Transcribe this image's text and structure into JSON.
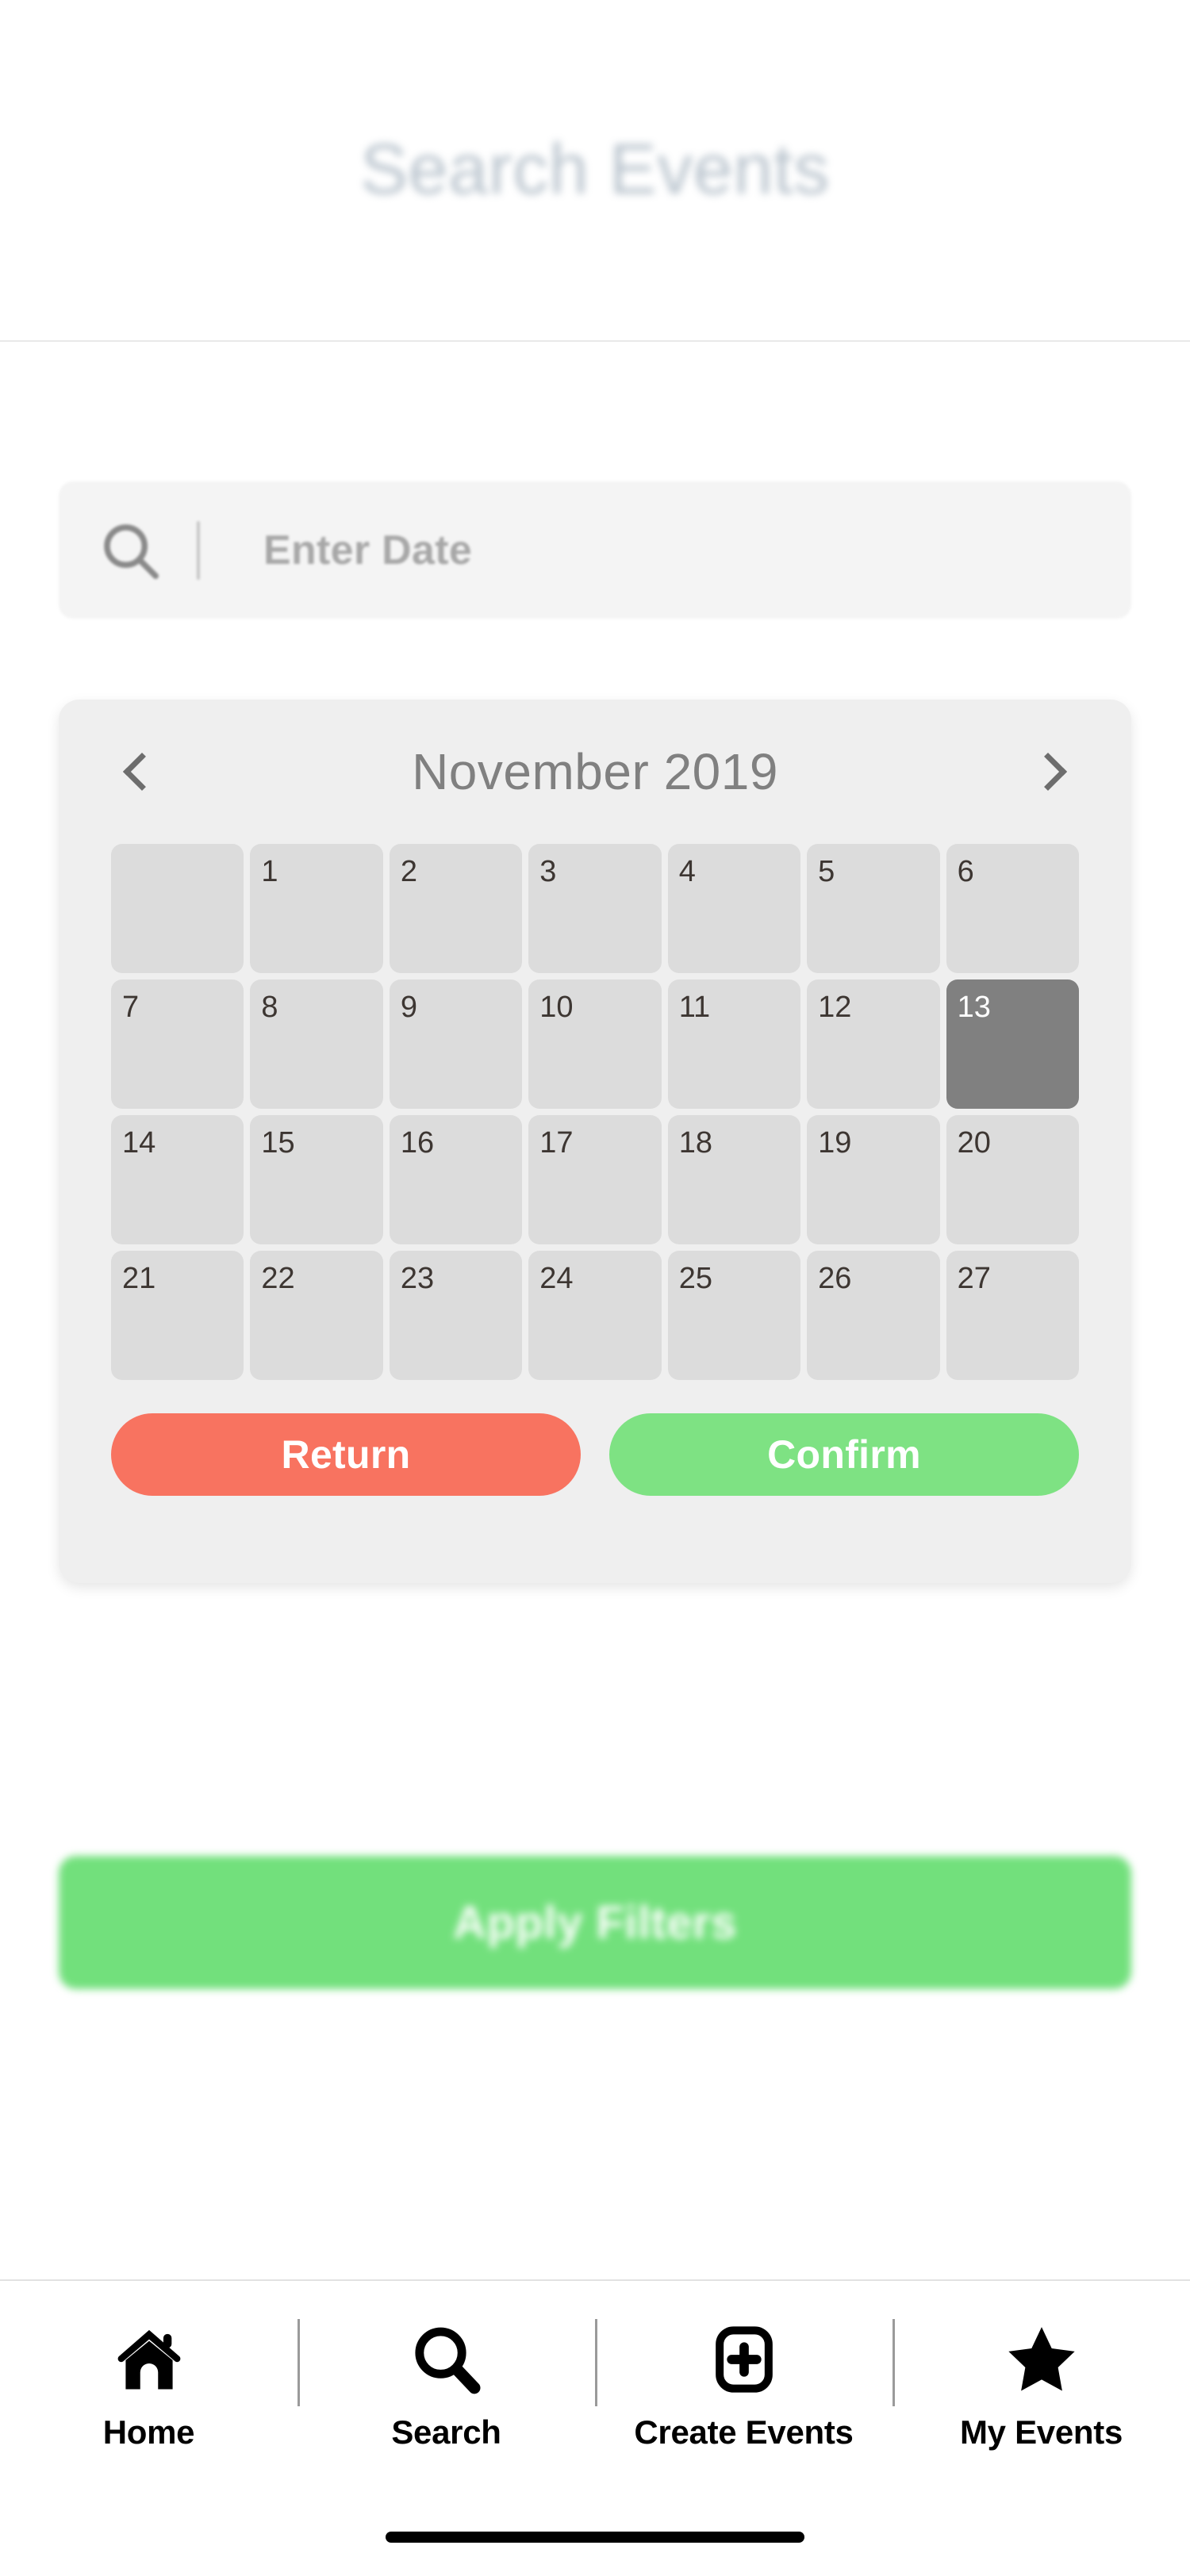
{
  "header": {
    "title": "Search Events"
  },
  "search": {
    "icon": "search-icon",
    "placeholder": "Enter Date",
    "value": ""
  },
  "calendar": {
    "prev_icon": "chevron-left-icon",
    "next_icon": "chevron-right-icon",
    "month_year": "November 2019",
    "month": "November",
    "year": "2019",
    "leading_blanks": 1,
    "days": [
      "1",
      "2",
      "3",
      "4",
      "5",
      "6",
      "7",
      "8",
      "9",
      "10",
      "11",
      "12",
      "13",
      "14",
      "15",
      "16",
      "17",
      "18",
      "19",
      "20",
      "21",
      "22",
      "23",
      "24",
      "25",
      "26",
      "27"
    ],
    "selected_day": "13",
    "return_label": "Return",
    "confirm_label": "Confirm",
    "colors": {
      "card_bg": "#efefef",
      "cell_bg": "#dcdcdc",
      "selected_bg": "#808080",
      "return_bg": "#f87360",
      "confirm_bg": "#7ee283"
    }
  },
  "filters": {
    "apply_label": "Apply Filters",
    "apply_color": "#72e07c"
  },
  "bottom_nav": {
    "active": "Search",
    "active_indicator_color": "#2f4f3e",
    "items": [
      {
        "label": "Home",
        "icon": "home-icon"
      },
      {
        "label": "Search",
        "icon": "search-icon"
      },
      {
        "label": "Create Events",
        "icon": "plus-square-icon"
      },
      {
        "label": "My Events",
        "icon": "star-icon"
      }
    ]
  }
}
